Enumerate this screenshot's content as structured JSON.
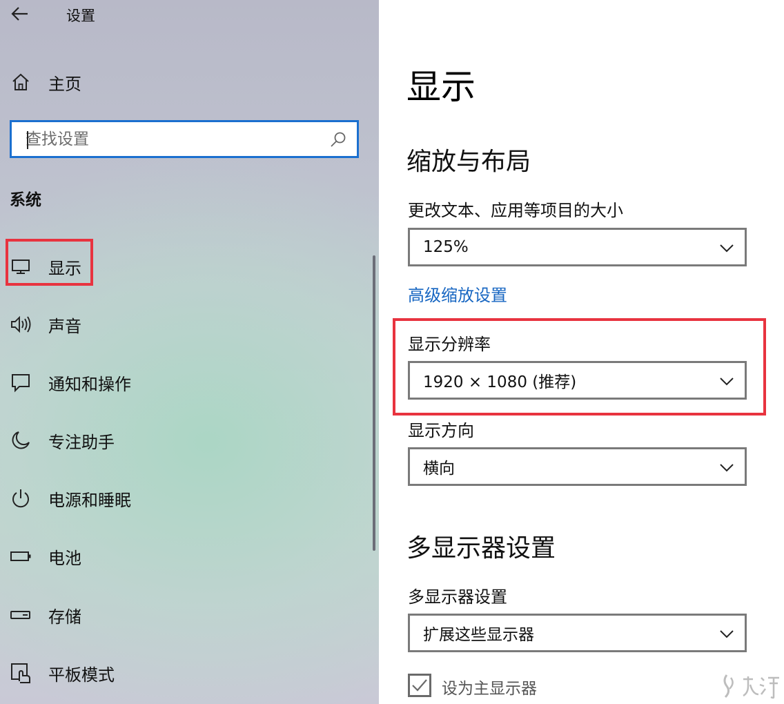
{
  "window": {
    "title": "设置"
  },
  "sidebar": {
    "home_label": "主页",
    "search": {
      "placeholder": "查找设置",
      "value": ""
    },
    "section_label": "系统",
    "items": [
      {
        "label": "显示",
        "icon": "monitor-icon",
        "selected": true
      },
      {
        "label": "声音",
        "icon": "speaker-icon"
      },
      {
        "label": "通知和操作",
        "icon": "notification-icon"
      },
      {
        "label": "专注助手",
        "icon": "moon-icon"
      },
      {
        "label": "电源和睡眠",
        "icon": "power-icon"
      },
      {
        "label": "电池",
        "icon": "battery-icon"
      },
      {
        "label": "存储",
        "icon": "storage-icon"
      },
      {
        "label": "平板模式",
        "icon": "tablet-mode-icon"
      }
    ]
  },
  "main": {
    "title": "显示",
    "scale_layout": {
      "heading": "缩放与布局",
      "scale_label": "更改文本、应用等项目的大小",
      "scale_value": "125%",
      "advanced_scaling_link": "高级缩放设置",
      "resolution_label": "显示分辨率",
      "resolution_value": "1920 × 1080 (推荐)",
      "orientation_label": "显示方向",
      "orientation_value": "横向"
    },
    "multi_display": {
      "heading": "多显示器设置",
      "label": "多显示器设置",
      "value": "扩展这些显示器",
      "primary_checkbox_label": "设为主显示器",
      "primary_checked": true
    }
  },
  "colors": {
    "accent": "#1a6fcf",
    "link": "#1766c2",
    "annotation_red": "#e8333f"
  },
  "watermark_icon": "jiuyou-logo-icon"
}
